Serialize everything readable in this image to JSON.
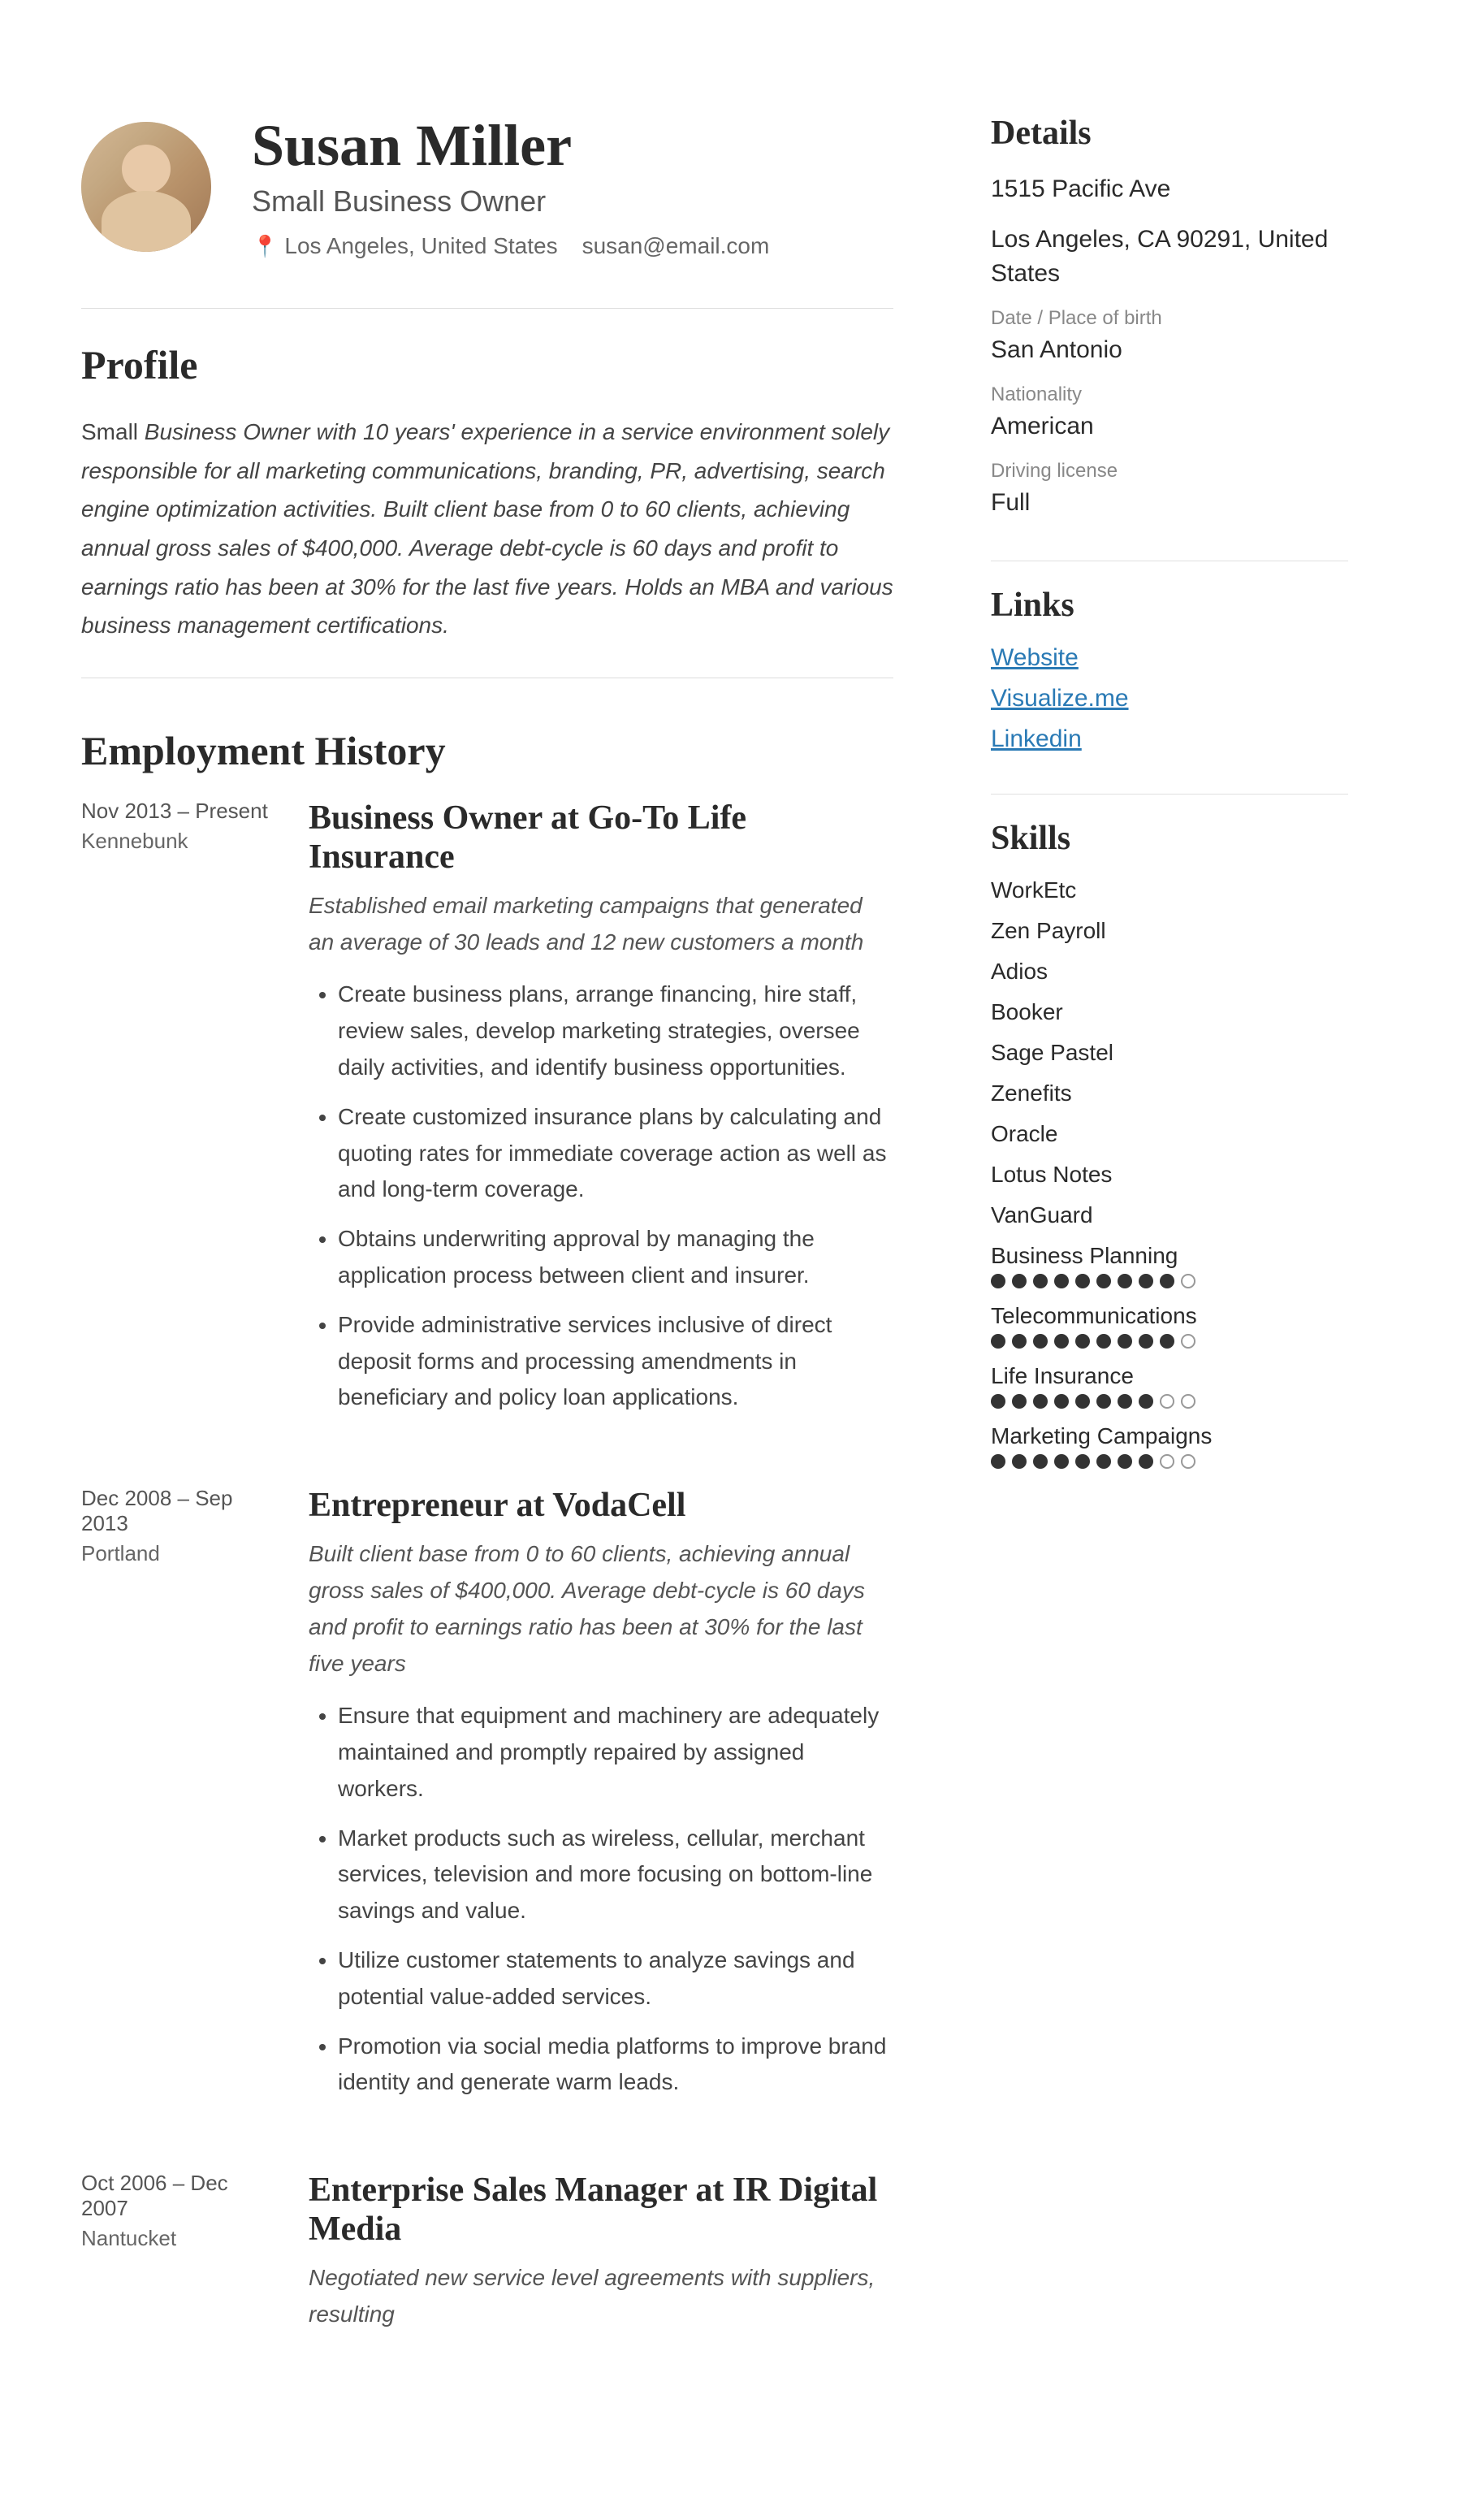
{
  "header": {
    "name": "Susan Miller",
    "job_title": "Small Business Owner",
    "location": "Los Angeles, United States",
    "email": "susan@email.com"
  },
  "profile": {
    "section_label": "Profile",
    "text_part1": "Small ",
    "text_italic": "Business Owner with 10 years' experience in a service environment solely responsible for all marketing communications, branding, PR, advertising, search engine optimization activities. Built client base from 0 to 60 clients, achieving annual gross sales of $400,000. Average debt-cycle is 60 days and profit to earnings ratio has been at 30% for the last five years. Holds an MBA and various business management certifications."
  },
  "employment": {
    "section_label": "Employment History",
    "jobs": [
      {
        "dates": "Nov 2013 – Present",
        "location": "Kennebunk",
        "title": "Business Owner at Go-To Life Insurance",
        "summary": "Established email marketing campaigns that generated an average of 30 leads and 12 new customers a month",
        "bullets": [
          "Create business plans, arrange financing, hire staff, review sales, develop marketing strategies, oversee daily activities, and identify business opportunities.",
          "Create customized insurance plans by calculating and quoting rates for immediate coverage action as well as and long-term coverage.",
          "Obtains underwriting approval by managing the application process between client and insurer.",
          "Provide administrative services inclusive of direct deposit forms and processing amendments in beneficiary and policy loan applications."
        ]
      },
      {
        "dates": "Dec 2008 – Sep 2013",
        "location": "Portland",
        "title": "Entrepreneur at VodaCell",
        "summary": "Built client base from 0 to 60 clients, achieving annual gross sales of $400,000. Average debt-cycle is 60 days and profit to earnings ratio has been at 30% for the last five years",
        "bullets": [
          "Ensure that equipment and machinery are adequately maintained and promptly repaired by assigned workers.",
          "Market products such as wireless, cellular, merchant services, television and more focusing on bottom-line savings and value.",
          "Utilize customer statements to analyze savings and potential value-added services.",
          "Promotion via social media platforms to improve brand identity and generate warm leads."
        ]
      },
      {
        "dates": "Oct 2006 – Dec 2007",
        "location": "Nantucket",
        "title": "Enterprise Sales Manager at IR Digital Media",
        "summary": "Negotiated new service level agreements with suppliers, resulting",
        "bullets": []
      }
    ]
  },
  "sidebar": {
    "details": {
      "heading": "Details",
      "address_line1": "1515 Pacific Ave",
      "address_line2": "Los Angeles, CA 90291, United States",
      "dob_label": "Date / Place of birth",
      "dob_value": "San Antonio",
      "nationality_label": "Nationality",
      "nationality_value": "American",
      "driving_label": "Driving license",
      "driving_value": "Full"
    },
    "links": {
      "heading": "Links",
      "items": [
        "Website",
        "Visualize.me",
        "Linkedin"
      ]
    },
    "skills": {
      "heading": "Skills",
      "simple": [
        "WorkEtc",
        "Zen Payroll",
        "Adios",
        "Booker",
        "Sage Pastel",
        "Zenefits",
        "Oracle",
        "Lotus Notes",
        "VanGuard"
      ],
      "with_dots": [
        {
          "name": "Business Planning",
          "filled": 9,
          "total": 10
        },
        {
          "name": "Telecommunications",
          "filled": 9,
          "total": 10
        },
        {
          "name": "Life Insurance",
          "filled": 8,
          "total": 10
        },
        {
          "name": "Marketing Campaigns",
          "filled": 8,
          "total": 10
        }
      ]
    }
  }
}
